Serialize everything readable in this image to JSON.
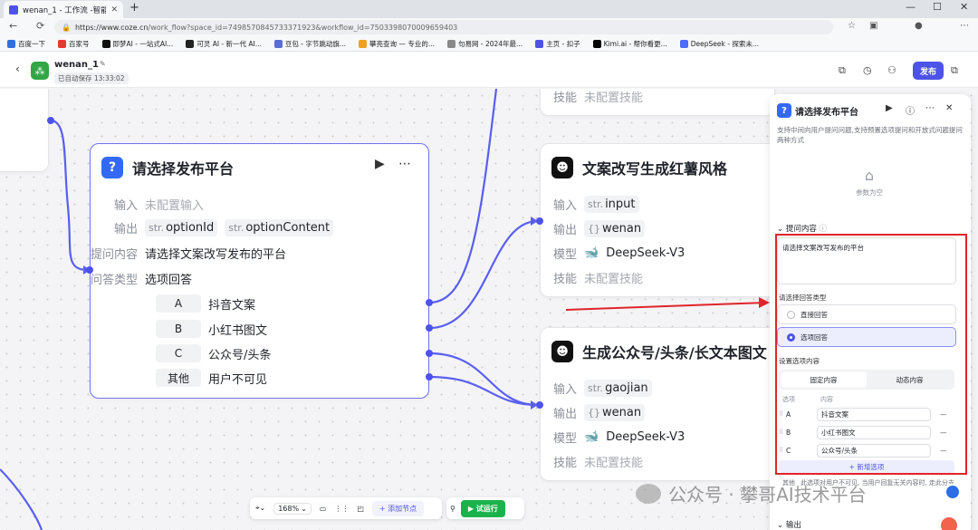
{
  "browser": {
    "tab_title": "wenan_1 - 工作流 -智能体平台",
    "tab_close": "✕",
    "new_tab": "+",
    "win_min": "—",
    "win_max": "☐",
    "win_close": "✕",
    "url_host": "https://www.coze.cn",
    "url_path": "/work_flow?space_id=7498570845733371923&workflow_id=7503398070009659403",
    "bookmarks": [
      "百度一下",
      "百家号",
      "即梦AI - 一站式AI...",
      "可灵 AI - 新一代 AI...",
      "豆包 - 字节跳动旗...",
      "攀亮查询 — 专业的...",
      "句易网 - 2024年最...",
      "主页 - 扣子",
      "Kimi.ai - 帮你看更...",
      "DeepSeek - 探索未..."
    ]
  },
  "app": {
    "name": "wenan_1",
    "saved": "已自动保存 13:33:02",
    "publish": "发布"
  },
  "nodes": {
    "question": {
      "title": "请选择发布平台",
      "input_label": "输入",
      "input_value": "未配置输入",
      "output_label": "输出",
      "out1_type": "str.",
      "out1_name": "optionId",
      "out2_type": "str.",
      "out2_name": "optionContent",
      "prompt_label": "提问内容",
      "prompt_value": "请选择文案改写发布的平台",
      "qtype_label": "问答类型",
      "qtype_value": "选项回答",
      "options": [
        {
          "key": "A",
          "value": "抖音文案"
        },
        {
          "key": "B",
          "value": "小红书图文"
        },
        {
          "key": "C",
          "value": "公众号/头条"
        },
        {
          "key": "其他",
          "value": "用户不可见"
        }
      ]
    },
    "top_partial": {
      "skill_label": "技能",
      "skill_value": "未配置技能"
    },
    "xhs": {
      "title": "文案改写生成红薯风格",
      "input_label": "输入",
      "input_type": "str.",
      "input_name": "input",
      "output_label": "输出",
      "output_type": "{}",
      "output_name": "wenan",
      "model_label": "模型",
      "model_value": "DeepSeek-V3",
      "skill_label": "技能",
      "skill_value": "未配置技能"
    },
    "gzh": {
      "title": "生成公众号/头条/长文本图文",
      "input_label": "输入",
      "input_type": "str.",
      "input_name": "gaojian",
      "output_label": "输出",
      "output_type": "{}",
      "output_name": "wenan",
      "model_label": "模型",
      "model_value": "DeepSeek-V3",
      "skill_label": "技能",
      "skill_value": "未配置技能"
    }
  },
  "panel": {
    "title": "请选择发布平台",
    "desc": "支持中间向用户提问问题,支持预置选项提问和开放式问题提问两种方式",
    "empty": "参数为空",
    "prompt_section": "提问内容",
    "prompt_text": "请选择文案改写发布的平台",
    "answer_type_label": "请选择回答类型",
    "radio_direct": "直接回答",
    "radio_option": "选项回答",
    "option_section": "设置选项内容",
    "seg_fixed": "固定内容",
    "seg_dynamic": "动态内容",
    "col_option": "选项",
    "col_content": "内容",
    "options": [
      {
        "key": "A",
        "value": "抖音文案"
      },
      {
        "key": "B",
        "value": "小红书图文"
      },
      {
        "key": "C",
        "value": "公众号/头条"
      }
    ],
    "add_option": "+ 新增选项",
    "footer_key": "其他",
    "footer_text": "此选项对用户不可见, 当用户回复无关内容时, 走此分支",
    "output_section": "输出"
  },
  "toolbar": {
    "zoom": "168%",
    "add_node": "+ 添加节点",
    "run": "试运行"
  },
  "watermark": {
    "text": "公众号 · 攀哥AI技术平台"
  },
  "colors": {
    "accent": "#4d53e8",
    "run_green": "#1cb24b",
    "highlight_red": "#e0242b"
  }
}
